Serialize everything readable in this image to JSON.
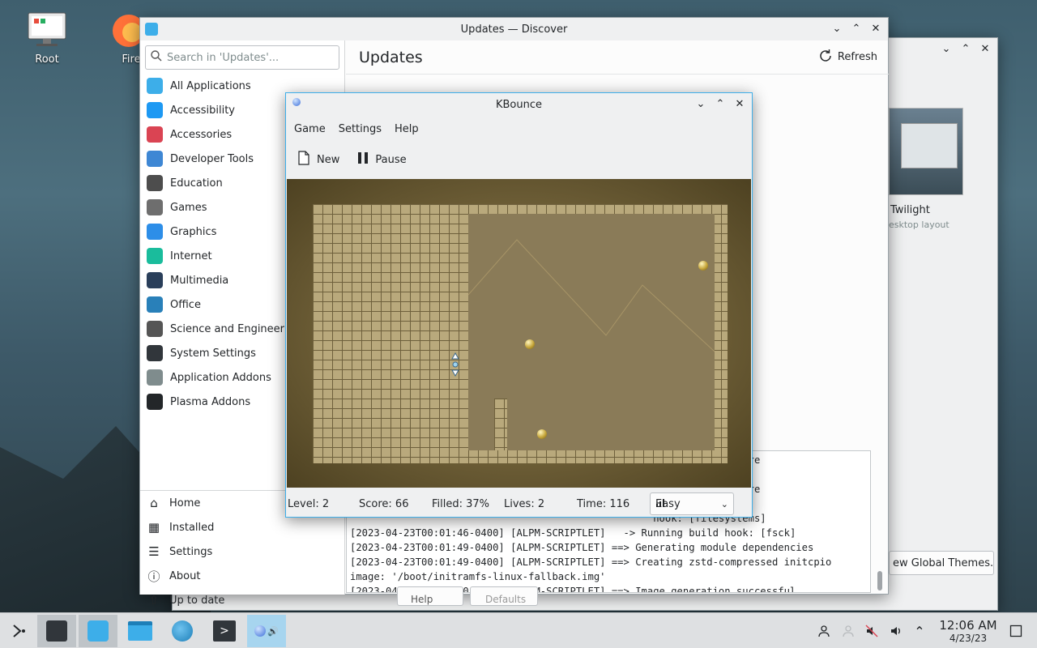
{
  "desktop": {
    "icons": [
      {
        "label": "Root"
      },
      {
        "label": "Fire"
      }
    ]
  },
  "back_window": {
    "theme_name": "Twilight",
    "theme_sub": "esktop layout",
    "new_themes_button": "ew Global Themes...",
    "help_button": "Help",
    "defaults_button": "Defaults"
  },
  "discover": {
    "title": "Updates — Discover",
    "search_placeholder": "Search in 'Updates'...",
    "page_title": "Updates",
    "refresh_label": "Refresh",
    "categories": [
      {
        "label": "All Applications",
        "color": "#3daee9"
      },
      {
        "label": "Accessibility",
        "color": "#1d99f3"
      },
      {
        "label": "Accessories",
        "color": "#da4453"
      },
      {
        "label": "Developer Tools",
        "color": "#3e87d4"
      },
      {
        "label": "Education",
        "color": "#4d4d4d"
      },
      {
        "label": "Games",
        "color": "#6e6e6e"
      },
      {
        "label": "Graphics",
        "color": "#2d8ee8"
      },
      {
        "label": "Internet",
        "color": "#1abc9c"
      },
      {
        "label": "Multimedia",
        "color": "#2a3f5a"
      },
      {
        "label": "Office",
        "color": "#2980b9"
      },
      {
        "label": "Science and Engineering",
        "color": "#555"
      },
      {
        "label": "System Settings",
        "color": "#31363b"
      },
      {
        "label": "Application Addons",
        "color": "#7f8c8d"
      },
      {
        "label": "Plasma Addons",
        "color": "#232629"
      }
    ],
    "nav": [
      {
        "label": "Home",
        "icon": "⌂"
      },
      {
        "label": "Installed",
        "icon": "▦"
      },
      {
        "label": "Settings",
        "icon": "☰"
      },
      {
        "label": "About",
        "icon": "ⓘ"
      },
      {
        "label": "Up to date",
        "icon": "⇧"
      }
    ],
    "log_lines": [
      "                                                   y missing firmware",
      "",
      "                                                   y missing firmware",
      "",
      "                                                   hook: [filesystems]",
      "[2023-04-23T00:01:46-0400] [ALPM-SCRIPTLET]   -> Running build hook: [fsck]",
      "[2023-04-23T00:01:49-0400] [ALPM-SCRIPTLET] ==> Generating module dependencies",
      "[2023-04-23T00:01:49-0400] [ALPM-SCRIPTLET] ==> Creating zstd-compressed initcpio",
      "image: '/boot/initramfs-linux-fallback.img'",
      "[2023-04-23T00:01:50-0400] [ALPM-SCRIPTLET] ==> Image generation successful"
    ]
  },
  "kbounce": {
    "title": "KBounce",
    "menu": [
      "Game",
      "Settings",
      "Help"
    ],
    "toolbar": {
      "new_label": "New",
      "pause_label": "Pause"
    },
    "status": {
      "level": "Level: 2",
      "score": "Score: 66",
      "filled": "Filled: 37%",
      "lives": "Lives: 2",
      "time": "Time: 116"
    },
    "difficulty": "Easy"
  },
  "taskbar": {
    "clock_time": "12:06 AM",
    "clock_date": "4/23/23"
  }
}
